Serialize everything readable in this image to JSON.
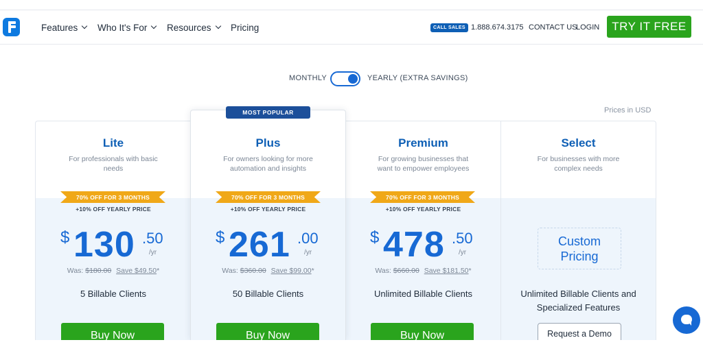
{
  "nav": {
    "items": [
      {
        "label": "Features",
        "dropdown": true
      },
      {
        "label": "Who It's For",
        "dropdown": true
      },
      {
        "label": "Resources",
        "dropdown": true
      },
      {
        "label": "Pricing",
        "dropdown": false
      }
    ],
    "call_badge": "CALL SALES",
    "phone": "1.888.674.3175",
    "contact": "CONTACT US",
    "login": "LOGIN",
    "try_button": "TRY IT FREE"
  },
  "billing_toggle": {
    "monthly_label": "MONTHLY",
    "yearly_label": "YEARLY (EXTRA SAVINGS)",
    "selected": "yearly"
  },
  "currency_note": "Prices in USD",
  "plans": [
    {
      "name": "Lite",
      "description": "For professionals with basic needs",
      "promo": "70% OFF FOR 3 MONTHS",
      "extra": "+10% OFF YEARLY PRICE",
      "currency": "$",
      "amount": "130",
      "cents": ".50",
      "period": "/yr",
      "was_label": "Was:",
      "was_price": "$180.00",
      "save": "Save $49.50",
      "asterisk": "*",
      "clients": "5 Billable Clients",
      "button": "Buy Now"
    },
    {
      "name": "Plus",
      "badge": "MOST POPULAR",
      "description": "For owners looking for more automation and insights",
      "promo": "70% OFF FOR 3 MONTHS",
      "extra": "+10% OFF YEARLY PRICE",
      "currency": "$",
      "amount": "261",
      "cents": ".00",
      "period": "/yr",
      "was_label": "Was:",
      "was_price": "$360.00",
      "save": "Save $99.00",
      "asterisk": "*",
      "clients": "50 Billable Clients",
      "button": "Buy Now"
    },
    {
      "name": "Premium",
      "description": "For growing businesses that want to empower employees",
      "promo": "70% OFF FOR 3 MONTHS",
      "extra": "+10% OFF YEARLY PRICE",
      "currency": "$",
      "amount": "478",
      "cents": ".50",
      "period": "/yr",
      "was_label": "Was:",
      "was_price": "$660.00",
      "save": "Save $181.50",
      "asterisk": "*",
      "clients": "Unlimited Billable Clients",
      "button": "Buy Now"
    },
    {
      "name": "Select",
      "description": "For businesses with more complex needs",
      "custom_line1": "Custom",
      "custom_line2": "Pricing",
      "clients_line1": "Unlimited Billable Clients and",
      "clients_line2": "Specialized Features",
      "button": "Request a Demo"
    }
  ],
  "colors": {
    "brand_blue": "#1769d4",
    "cta_green": "#2aa41d",
    "promo_orange": "#f0a818",
    "badge_navy": "#1c4f9a"
  },
  "icons": {
    "logo": "freshbooks-f-logo",
    "chat": "chat-bubble-icon",
    "dropdown": "chevron-down-icon"
  }
}
